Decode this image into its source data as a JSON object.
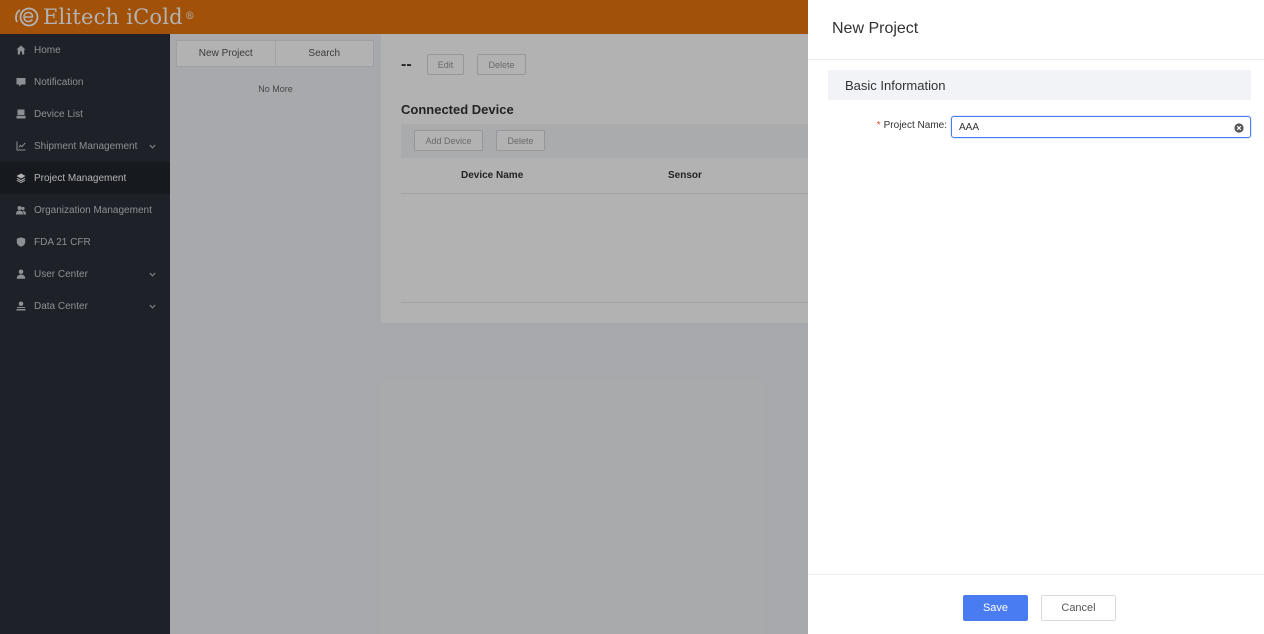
{
  "brand": {
    "name": "Elitech iCold",
    "trademark": "®",
    "color": "#e8740c"
  },
  "sidebar": {
    "items": [
      {
        "label": "Home",
        "icon": "home-icon"
      },
      {
        "label": "Notification",
        "icon": "message-icon"
      },
      {
        "label": "Device List",
        "icon": "device-icon"
      },
      {
        "label": "Shipment Management",
        "icon": "chart-icon",
        "expandable": true
      },
      {
        "label": "Project Management",
        "icon": "layers-icon",
        "active": true
      },
      {
        "label": "Organization Management",
        "icon": "users-icon"
      },
      {
        "label": "FDA 21 CFR",
        "icon": "shield-icon"
      },
      {
        "label": "User Center",
        "icon": "user-icon",
        "expandable": true
      },
      {
        "label": "Data Center",
        "icon": "data-icon",
        "expandable": true
      }
    ]
  },
  "project_list": {
    "tabs": [
      "New Project",
      "Search"
    ],
    "empty_text": "No More"
  },
  "main": {
    "project_title": "--",
    "edit_label": "Edit",
    "delete_label": "Delete",
    "section_title": "Connected Device",
    "add_device_label": "Add Device",
    "delete_device_label": "Delete",
    "columns": [
      "Device Name",
      "Sensor"
    ]
  },
  "drawer": {
    "title": "New Project",
    "section": "Basic Information",
    "required_mark": "*",
    "field_label": "Project Name:",
    "field_value": "AAA",
    "save_label": "Save",
    "cancel_label": "Cancel",
    "accent_color": "#4a7cf1"
  }
}
